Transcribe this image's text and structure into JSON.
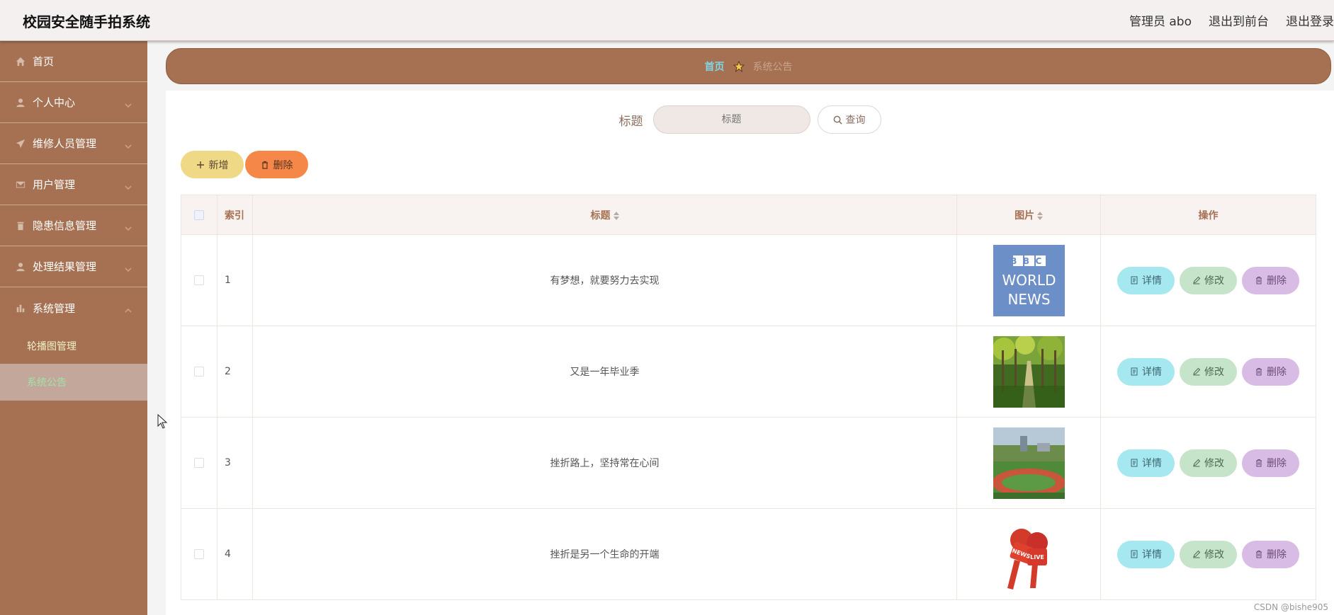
{
  "header": {
    "app_title": "校园安全随手拍系统",
    "user_label": "管理员 abo",
    "back_to_front": "退出到前台",
    "logout": "退出登录"
  },
  "sidebar": {
    "items": [
      {
        "label": "首页",
        "icon": "home-icon"
      },
      {
        "label": "个人中心",
        "icon": "user-icon"
      },
      {
        "label": "维修人员管理",
        "icon": "send-icon"
      },
      {
        "label": "用户管理",
        "icon": "mail-icon"
      },
      {
        "label": "隐患信息管理",
        "icon": "trash-icon"
      },
      {
        "label": "处理结果管理",
        "icon": "user-icon"
      },
      {
        "label": "系统管理",
        "icon": "chart-icon"
      }
    ],
    "sub_items": [
      {
        "label": "轮播图管理"
      },
      {
        "label": "系统公告",
        "active": true
      }
    ]
  },
  "breadcrumb": {
    "home": "首页",
    "current": "系统公告"
  },
  "search": {
    "label": "标题",
    "placeholder": "标题",
    "button": "查询"
  },
  "actions": {
    "add": "新增",
    "delete": "删除"
  },
  "table": {
    "columns": [
      "索引",
      "标题",
      "图片",
      "操作"
    ],
    "rows": [
      {
        "index": "1",
        "title": "有梦想，就要努力去实现",
        "image": "bbc-world-news"
      },
      {
        "index": "2",
        "title": "又是一年毕业季",
        "image": "tree-lined-path"
      },
      {
        "index": "3",
        "title": "挫折路上，坚持常在心间",
        "image": "campus-sports-field"
      },
      {
        "index": "4",
        "title": "挫折是另一个生命的开端",
        "image": "news-microphones"
      }
    ],
    "row_actions": {
      "detail": "详情",
      "edit": "修改",
      "delete": "删除"
    }
  },
  "thumbnail_text": {
    "bbc_line1": "BBC",
    "bbc_line2": "WORLD",
    "bbc_line3": "NEWS",
    "mic_news": "NEWS",
    "mic_live": "LIVE"
  },
  "watermark": "CSDN @bishe905",
  "colors": {
    "sidebar": "#a57152",
    "accent_text": "#a57152",
    "add_button": "#efd987",
    "delete_button": "#f58848",
    "detail_button": "#a5e8f0",
    "edit_button": "#c6e4c9",
    "row_delete_button": "#d9bce6"
  }
}
